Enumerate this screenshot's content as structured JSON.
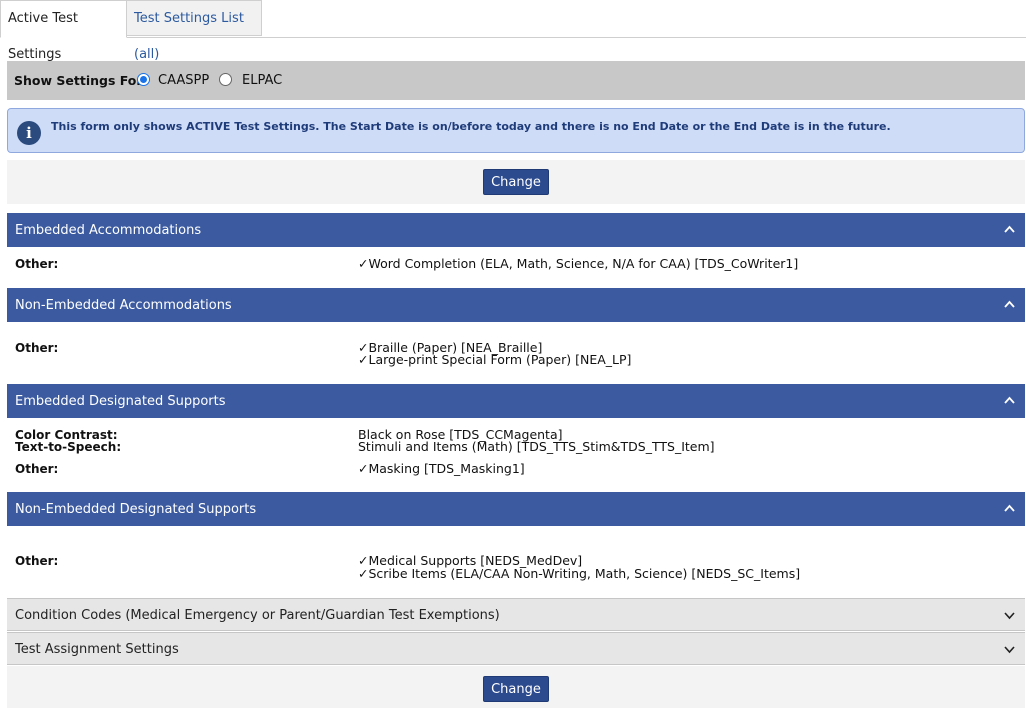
{
  "tabs": {
    "active": "Active Test Settings",
    "list": "Test Settings List (all)"
  },
  "show_settings": {
    "label": "Show Settings For:",
    "options": [
      "CAASPP",
      "ELPAC"
    ],
    "selected": "CAASPP"
  },
  "info": {
    "message": "This form only shows ACTIVE Test Settings.  The Start Date is on/before today and there is no End Date or the End Date is in the future.",
    "icon": "info-icon"
  },
  "change_label": "Change",
  "sections": {
    "embedded_accommodations": {
      "title": "Embedded Accommodations",
      "rows": [
        {
          "label": "Other:",
          "values": [
            "✓Word Completion (ELA, Math, Science, N/A for CAA) [TDS_CoWriter1]"
          ]
        }
      ]
    },
    "non_embedded_accommodations": {
      "title": "Non-Embedded Accommodations",
      "rows": [
        {
          "label": "Other:",
          "values": [
            "✓Braille (Paper) [NEA_Braille]",
            "✓Large-print Special Form (Paper) [NEA_LP]"
          ]
        }
      ]
    },
    "embedded_designated_supports": {
      "title": "Embedded Designated Supports",
      "rows": [
        {
          "label": "Color Contrast:",
          "values": [
            "Black on Rose [TDS_CCMagenta]"
          ]
        },
        {
          "label": "Text-to-Speech:",
          "values": [
            "Stimuli and Items (Math) [TDS_TTS_Stim&TDS_TTS_Item]"
          ]
        },
        {
          "label": "Other:",
          "values": [
            "✓Masking [TDS_Masking1]"
          ]
        }
      ]
    },
    "non_embedded_designated_supports": {
      "title": "Non-Embedded Designated Supports",
      "rows": [
        {
          "label": "Other:",
          "values": [
            "✓Medical Supports [NEDS_MedDev]",
            "✓Scribe Items (ELA/CAA Non-Writing, Math, Science) [NEDS_SC_Items]"
          ]
        }
      ]
    },
    "condition_codes": {
      "title": "Condition Codes (Medical Emergency or Parent/Guardian Test Exemptions)"
    },
    "test_assignment": {
      "title": "Test Assignment Settings"
    }
  }
}
